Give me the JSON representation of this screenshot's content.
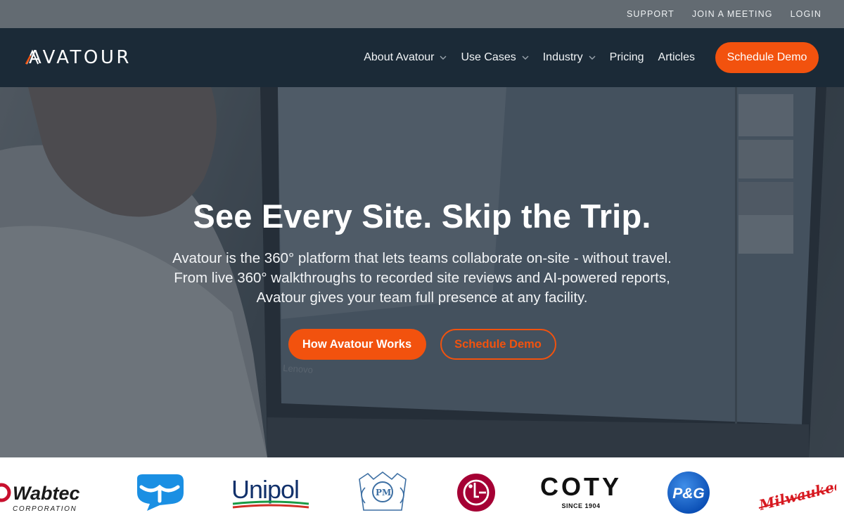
{
  "util_bar": {
    "links": [
      "SUPPORT",
      "JOIN A MEETING",
      "LOGIN"
    ]
  },
  "nav": {
    "logo_text": "AVATOUR",
    "items": [
      {
        "label": "About Avatour",
        "dropdown": true
      },
      {
        "label": "Use Cases",
        "dropdown": true
      },
      {
        "label": "Industry",
        "dropdown": true
      },
      {
        "label": "Pricing",
        "dropdown": false
      },
      {
        "label": "Articles",
        "dropdown": false
      }
    ],
    "cta_label": "Schedule Demo"
  },
  "hero": {
    "title": "See Every Site. Skip the Trip.",
    "subtitle_lines": [
      "Avatour is the 360° platform that lets teams collaborate on-site - without travel.",
      "From live 360° walkthroughs to recorded site reviews and AI-powered reports,",
      "Avatour gives your team full presence at any facility."
    ],
    "primary_button": "How Avatour Works",
    "secondary_button": "Schedule Demo",
    "monitor_brand": "Lenovo"
  },
  "client_logos": [
    {
      "name": "Wabtec",
      "wordmark": "Wabtec",
      "tagline": "CORPORATION"
    },
    {
      "name": "Unknown blue mark"
    },
    {
      "name": "Unipol",
      "wordmark": "Unipol"
    },
    {
      "name": "Philip Morris International",
      "wordmark": "PM"
    },
    {
      "name": "LG"
    },
    {
      "name": "Coty",
      "wordmark": "COTY",
      "tagline": "SINCE 1904"
    },
    {
      "name": "P&G",
      "wordmark": "P&G"
    },
    {
      "name": "Milwaukee",
      "wordmark": "Milwaukee"
    }
  ],
  "colors": {
    "accent": "#f2520e",
    "nav_bg": "#1b2a37",
    "util_bg": "#636b72"
  }
}
